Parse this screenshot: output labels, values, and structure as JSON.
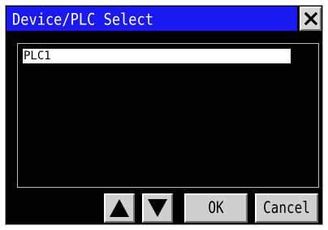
{
  "dialog": {
    "title": "Device/PLC Select",
    "close_icon": "close-icon"
  },
  "list": {
    "items": [
      {
        "label": "PLC1",
        "selected": true
      }
    ]
  },
  "buttons": {
    "up_icon": "arrow-up-icon",
    "down_icon": "arrow-down-icon",
    "ok_label": "OK",
    "cancel_label": "Cancel"
  },
  "colors": {
    "titlebar": "#1a1af0",
    "background": "#000000",
    "selection": "#ffffff",
    "button": "#cfcfcf"
  }
}
